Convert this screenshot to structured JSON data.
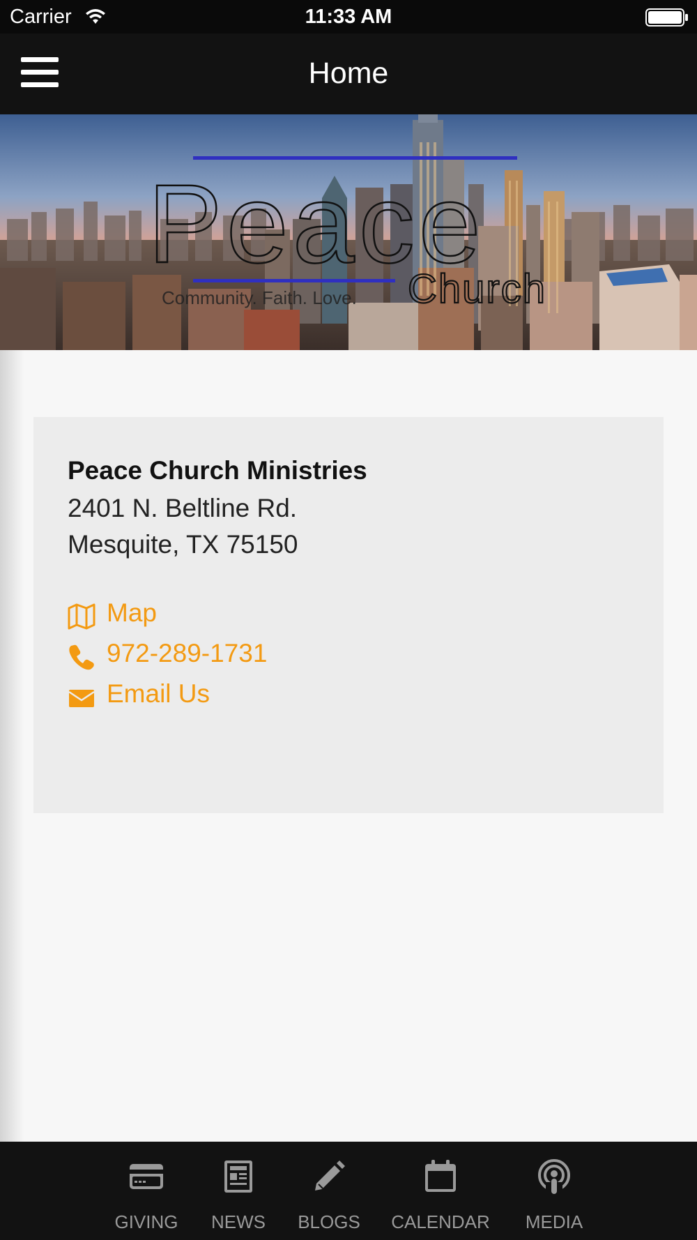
{
  "status_bar": {
    "carrier": "Carrier",
    "time": "11:33 AM"
  },
  "nav": {
    "title": "Home"
  },
  "hero": {
    "logo_text": "Peace",
    "logo_sub": "Church",
    "tagline": "Community. Faith. Love."
  },
  "church": {
    "name": "Peace Church Ministries",
    "address_line1": "2401 N. Beltline Rd.",
    "address_line2": "Mesquite, TX 75150"
  },
  "links": {
    "map": "Map",
    "phone": "972-289-1731",
    "email": "Email Us"
  },
  "tabs": [
    {
      "label": "GIVING",
      "icon": "credit-card-icon"
    },
    {
      "label": "NEWS",
      "icon": "newspaper-icon"
    },
    {
      "label": "BLOGS",
      "icon": "pencil-icon"
    },
    {
      "label": "CALENDAR",
      "icon": "calendar-icon"
    },
    {
      "label": "MEDIA",
      "icon": "podcast-icon"
    }
  ],
  "colors": {
    "accent": "#f39a12",
    "bar": "#121212",
    "tab_inactive": "#9a9a9a"
  }
}
